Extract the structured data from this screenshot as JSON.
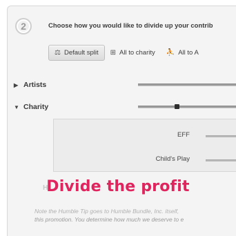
{
  "step": {
    "number": "2",
    "title": "Choose how you would like to divide up your contrib"
  },
  "tabs": [
    {
      "label": "Default split",
      "icon": "scale-icon"
    },
    {
      "label": "All to charity",
      "icon": "grid-icon"
    },
    {
      "label": "All to A",
      "icon": "person-icon"
    }
  ],
  "rows": {
    "artists": {
      "label": "Artists",
      "expanded": false,
      "value": 1.0
    },
    "charity": {
      "label": "Charity",
      "expanded": true,
      "value": 0.38
    }
  },
  "charities": [
    {
      "label": "EFF"
    },
    {
      "label": "Child's Play"
    }
  ],
  "faded_label": "H",
  "overlay_caption": "Divide the profit",
  "note_lines": [
    "Note the Humble Tip goes to Humble Bundle, Inc. itself,",
    "this promotion. You determine how much we deserve to e"
  ],
  "colors": {
    "accent": "#e0245e",
    "panel": "#f4f4f4"
  }
}
